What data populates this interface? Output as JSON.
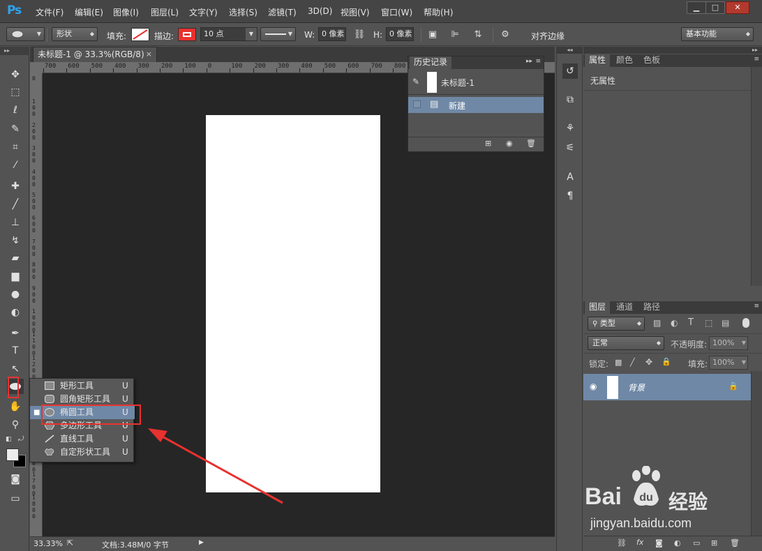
{
  "app": {
    "logo": "Ps"
  },
  "menubar": {
    "items": [
      "文件(F)",
      "编辑(E)",
      "图像(I)",
      "图层(L)",
      "文字(Y)",
      "选择(S)",
      "滤镜(T)",
      "3D(D)",
      "视图(V)",
      "窗口(W)",
      "帮助(H)"
    ],
    "window_buttons": [
      "▁",
      "□",
      "✕"
    ]
  },
  "options": {
    "mode": "形状",
    "fill_label": "填充:",
    "stroke_label": "描边:",
    "stroke_width": "10 点",
    "w_label": "W:",
    "w_value": "0 像素",
    "h_label": "H:",
    "h_value": "0 像素",
    "align_edges_label": "对齐边缘",
    "workspace": "基本功能"
  },
  "document": {
    "tab_title": "未标题-1 @ 33.3%(RGB/8)",
    "tab_close": "×",
    "ruler_top_ticks": [
      "700",
      "600",
      "500",
      "400",
      "300",
      "200",
      "100",
      "0",
      "100",
      "200",
      "300",
      "400",
      "500",
      "600",
      "700",
      "800"
    ],
    "ruler_left_ticks": [
      "0",
      "100",
      "200",
      "300",
      "400",
      "500",
      "600",
      "700",
      "800",
      "900",
      "1000",
      "1100",
      "1200",
      "1300",
      "1400",
      "1500",
      "1600",
      "1700",
      "1800"
    ],
    "zoom": "33.33%",
    "doc_info": "文档:3.48M/0 字节"
  },
  "history": {
    "tab": "历史记录",
    "snapshot_name": "未标题-1",
    "steps": [
      {
        "label": "新建"
      }
    ]
  },
  "properties": {
    "tabs": [
      "属性",
      "颜色",
      "色板"
    ],
    "empty_text": "无属性"
  },
  "layers": {
    "tabs": [
      "图层",
      "通道",
      "路径"
    ],
    "filter_kind": "类型",
    "blend_mode": "正常",
    "opacity_label": "不透明度:",
    "opacity_value": "100%",
    "lock_label": "锁定:",
    "fill_label": "填充:",
    "fill_value": "100%",
    "items": [
      {
        "name": "背景"
      }
    ]
  },
  "flyout": {
    "items": [
      {
        "label": "矩形工具",
        "key": "U"
      },
      {
        "label": "圆角矩形工具",
        "key": "U"
      },
      {
        "label": "椭圆工具",
        "key": "U",
        "selected": true
      },
      {
        "label": "多边形工具",
        "key": "U"
      },
      {
        "label": "直线工具",
        "key": "U"
      },
      {
        "label": "自定形状工具",
        "key": "U"
      }
    ]
  },
  "watermark": {
    "brand_left": "Bai",
    "brand_right": "经验",
    "url": "jingyan.baidu.com"
  },
  "colors": {
    "accent_red": "#e8322f",
    "selection_blue": "#6f88a6",
    "ps_blue": "#2fa3ec"
  }
}
